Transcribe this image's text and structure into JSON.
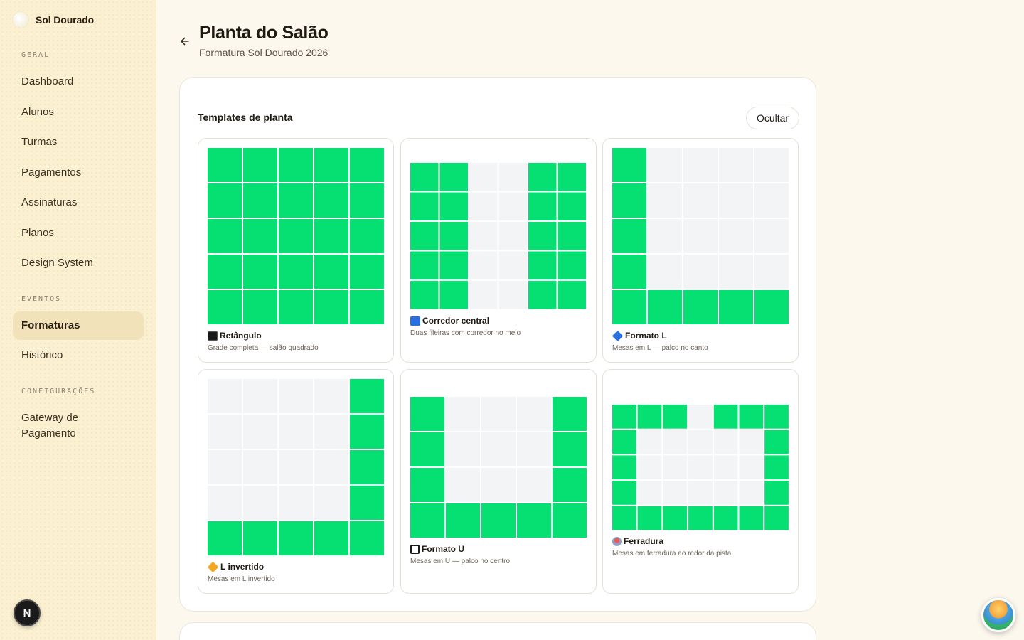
{
  "brand": {
    "name": "Sol Dourado"
  },
  "sidebar": {
    "sections": [
      {
        "label": "GERAL",
        "items": [
          "Dashboard",
          "Alunos",
          "Turmas",
          "Pagamentos",
          "Assinaturas",
          "Planos",
          "Design System"
        ]
      },
      {
        "label": "EVENTOS",
        "items": [
          "Formaturas",
          "Histórico"
        ]
      },
      {
        "label": "CONFIGURAÇÕES",
        "items": [
          "Gateway de Pagamento"
        ]
      }
    ],
    "active_item": "Formaturas"
  },
  "header": {
    "title": "Planta do Salão",
    "subtitle": "Formatura Sol Dourado 2026"
  },
  "templates_card": {
    "title": "Templates de planta",
    "hide_label": "Ocultar",
    "templates": [
      {
        "icon": "black-square-icon",
        "name": "Retângulo",
        "description": "Grade completa — salão quadrado"
      },
      {
        "icon": "blue-square-icon",
        "name": "Corredor central",
        "description": "Duas fileiras com corredor no meio"
      },
      {
        "icon": "blue-diamond-icon",
        "name": "Formato L",
        "description": "Mesas em L — palco no canto"
      },
      {
        "icon": "orange-diamond-icon",
        "name": "L invertido",
        "description": "Mesas em L invertido"
      },
      {
        "icon": "frame-square-icon",
        "name": "Formato U",
        "description": "Mesas em U — palco no centro"
      },
      {
        "icon": "circus-tent-icon",
        "name": "Ferradura",
        "description": "Mesas em ferradura ao redor da pista"
      }
    ]
  },
  "user_badge": {
    "initial": "N"
  },
  "colors": {
    "table_filled": "#06df72",
    "table_empty": "#f3f4f6",
    "sidebar_bg": "#fbf1d2",
    "active_nav_bg": "#f1e2b9"
  }
}
